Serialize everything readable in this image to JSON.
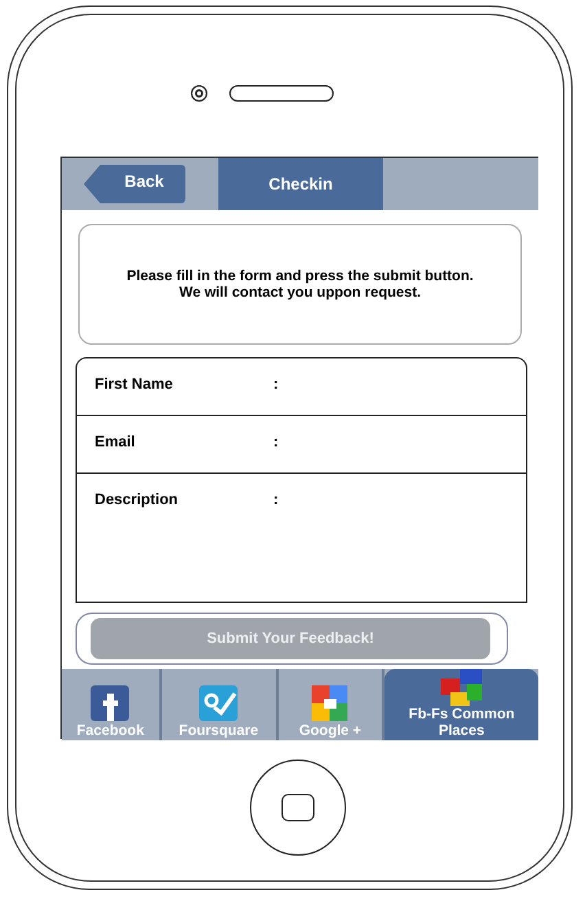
{
  "header": {
    "back": {
      "label": "Back"
    },
    "tabs": [
      {
        "label": "Checkin",
        "selected": true
      }
    ]
  },
  "intro": "Please fill in the form and press the submit button. We will contact you uppon request.",
  "form": {
    "fields": [
      {
        "label": "First Name",
        "colon": ":",
        "kind": "line"
      },
      {
        "label": "Email",
        "colon": ":",
        "kind": "line"
      },
      {
        "label": "Description",
        "colon": ":",
        "kind": "multiline"
      }
    ]
  },
  "submit": {
    "label": "Submit Your Feedback!",
    "disabled": true
  },
  "bottom_tabs": [
    {
      "label": "Facebook",
      "kind": "square",
      "selected": false
    },
    {
      "label": "Foursquare",
      "kind": "check",
      "selected": false
    },
    {
      "label": "Google +",
      "kind": "quadrant",
      "selected": false
    },
    {
      "label": "Fb-Fs Common Places",
      "kind": "puzzle",
      "selected": true
    }
  ]
}
